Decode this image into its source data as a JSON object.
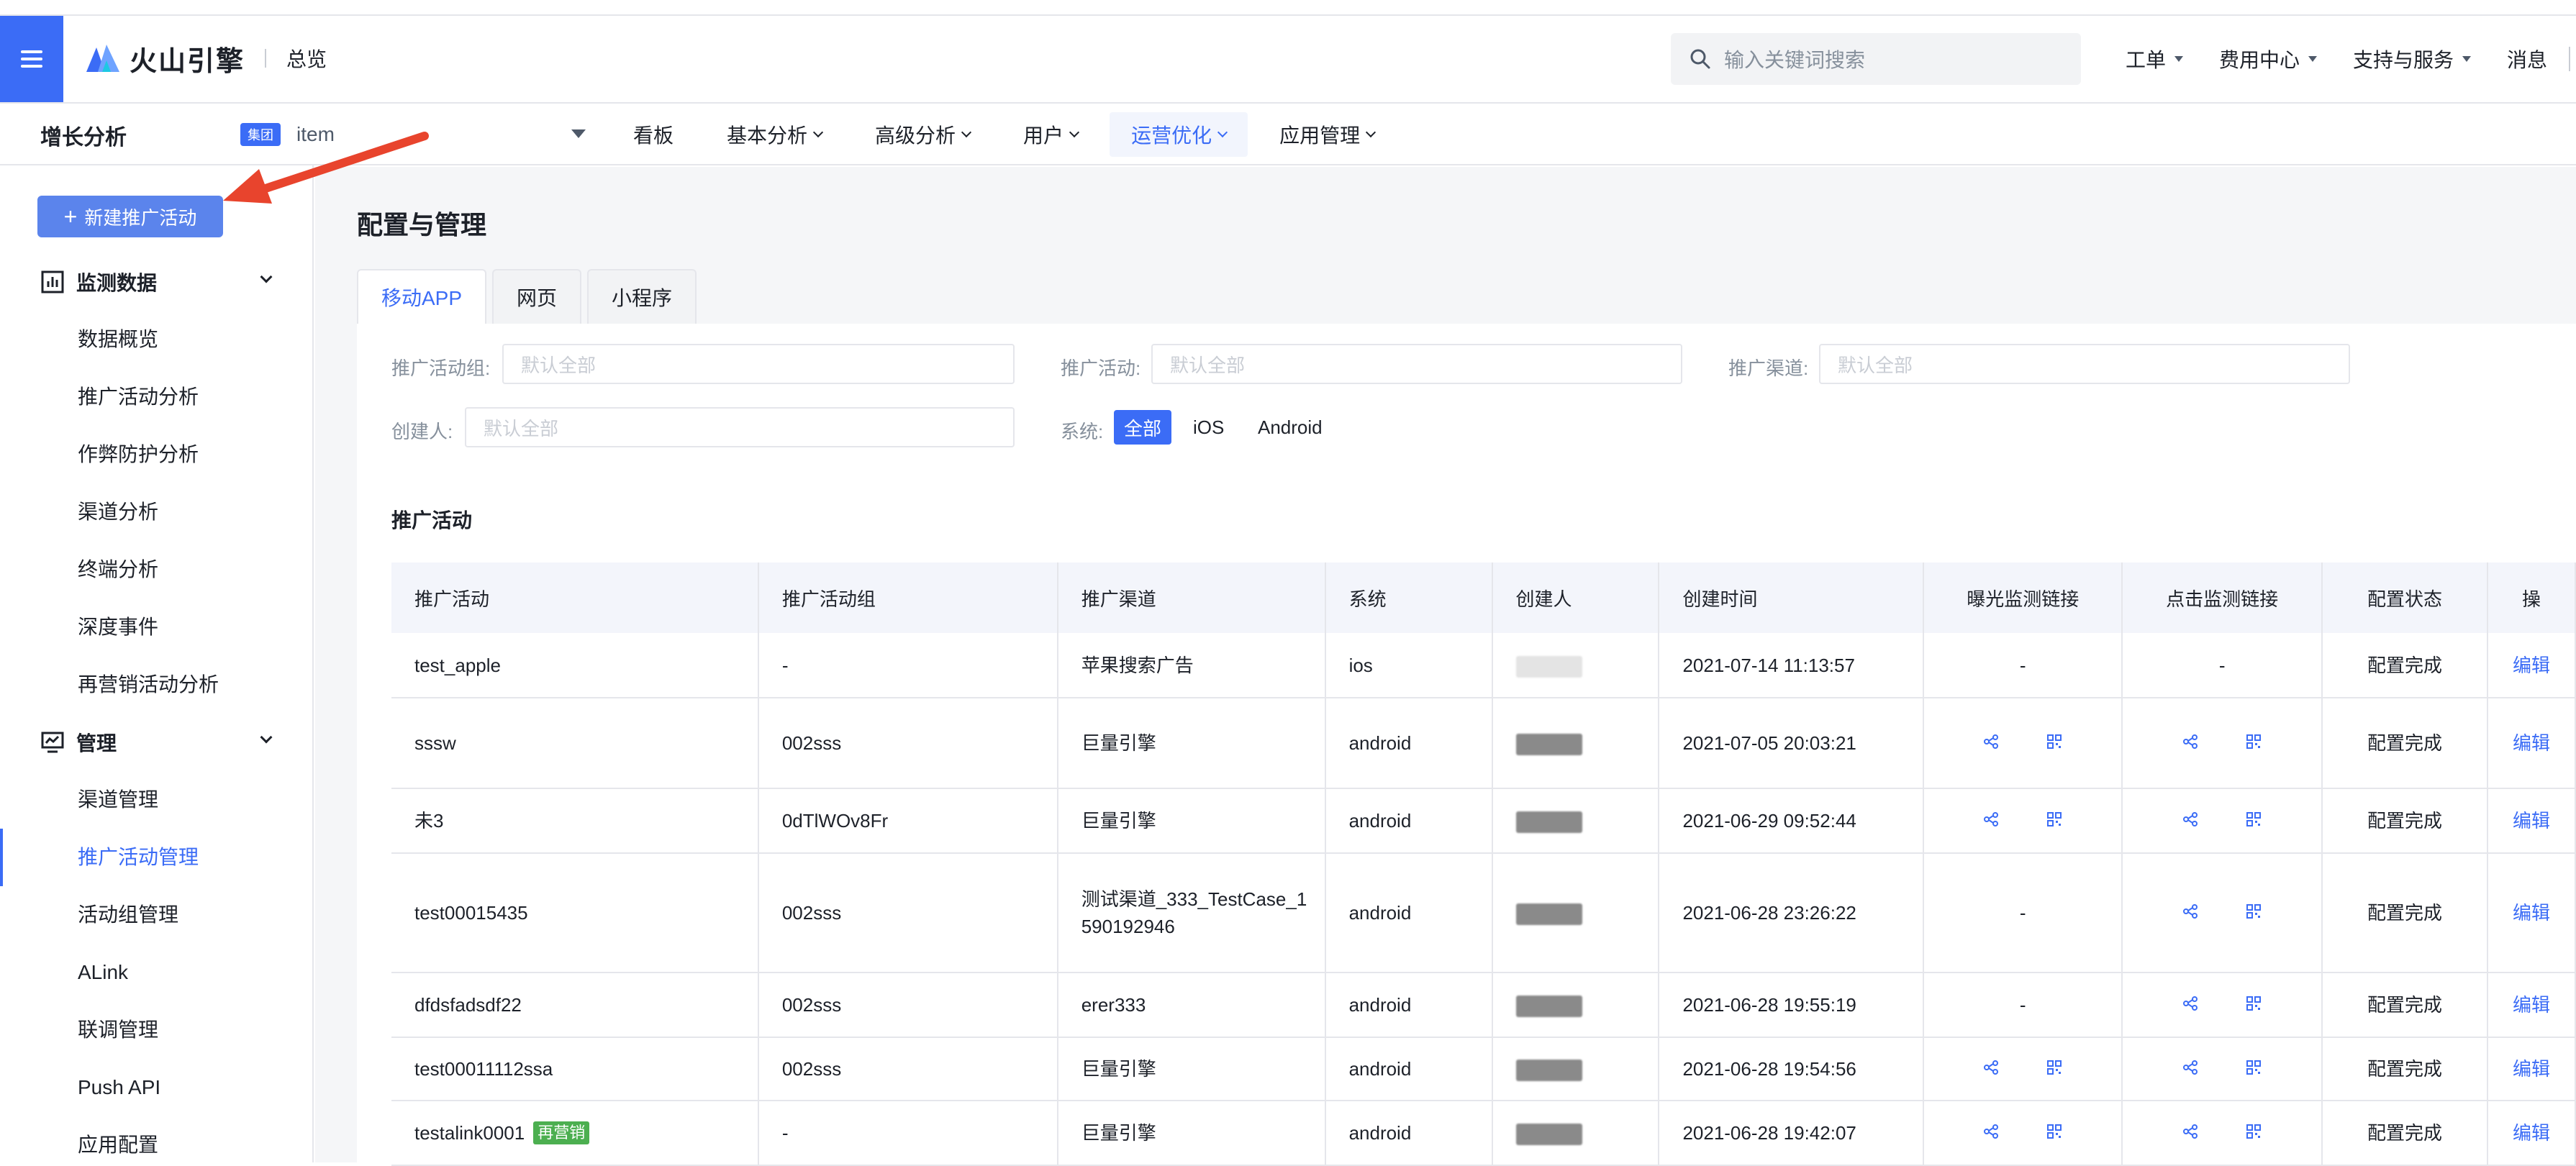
{
  "header": {
    "brand": "火山引擎",
    "section": "总览",
    "search_placeholder": "输入关键词搜索",
    "nav": [
      "工单",
      "费用中心",
      "支持与服务",
      "消息"
    ]
  },
  "subbar": {
    "product": "增长分析",
    "group_tag": "集团",
    "app_name": "item",
    "tabs": [
      "看板",
      "基本分析",
      "高级分析",
      "用户",
      "运营优化",
      "应用管理"
    ],
    "active_tab": "运营优化"
  },
  "sidebar": {
    "new_button": "新建推广活动",
    "group1": "监测数据",
    "group1_items": [
      "数据概览",
      "推广活动分析",
      "作弊防护分析",
      "渠道分析",
      "终端分析",
      "深度事件",
      "再营销活动分析"
    ],
    "group2": "管理",
    "group2_items": [
      "渠道管理",
      "推广活动管理",
      "活动组管理",
      "ALink",
      "联调管理",
      "Push API",
      "应用配置"
    ],
    "active_item": "推广活动管理"
  },
  "page": {
    "title": "配置与管理",
    "tabs": [
      "移动APP",
      "网页",
      "小程序"
    ],
    "active_tab": "移动APP"
  },
  "filters": {
    "group_label": "推广活动组:",
    "campaign_label": "推广活动:",
    "channel_label": "推广渠道:",
    "creator_label": "创建人:",
    "placeholder": "默认全部",
    "system_label": "系统:",
    "system_options": [
      "全部",
      "iOS",
      "Android"
    ],
    "system_selected": "全部"
  },
  "table": {
    "title": "推广活动",
    "columns": [
      "推广活动",
      "推广活动组",
      "推广渠道",
      "系统",
      "创建人",
      "创建时间",
      "曝光监测链接",
      "点击监测链接",
      "配置状态",
      "操"
    ],
    "rows": [
      {
        "name": "test_apple",
        "tag": "",
        "group": "-",
        "channel": "苹果搜索广告",
        "system": "ios",
        "time": "2021-07-14 11:13:57",
        "imp": "-",
        "click": "-",
        "status": "配置完成",
        "action": "编辑"
      },
      {
        "name": "sssw",
        "tag": "",
        "group": "002sss",
        "channel": "巨量引擎",
        "system": "android",
        "time": "2021-07-05 20:03:21",
        "imp": "icons",
        "click": "icons",
        "status": "配置完成",
        "action": "编辑"
      },
      {
        "name": "未3",
        "tag": "",
        "group": "0dTlWOv8Fr",
        "channel": "巨量引擎",
        "system": "android",
        "time": "2021-06-29 09:52:44",
        "imp": "icons",
        "click": "icons",
        "status": "配置完成",
        "action": "编辑"
      },
      {
        "name": "test00015435",
        "tag": "",
        "group": "002sss",
        "channel": "测试渠道_333_TestCase_1590192946",
        "system": "android",
        "time": "2021-06-28 23:26:22",
        "imp": "-",
        "click": "icons",
        "status": "配置完成",
        "action": "编辑"
      },
      {
        "name": "dfdsfadsdf22",
        "tag": "",
        "group": "002sss",
        "channel": "erer333",
        "system": "android",
        "time": "2021-06-28 19:55:19",
        "imp": "-",
        "click": "icons",
        "status": "配置完成",
        "action": "编辑"
      },
      {
        "name": "test00011112ssa",
        "tag": "",
        "group": "002sss",
        "channel": "巨量引擎",
        "system": "android",
        "time": "2021-06-28 19:54:56",
        "imp": "icons",
        "click": "icons",
        "status": "配置完成",
        "action": "编辑"
      },
      {
        "name": "testalink0001",
        "tag": "再营销",
        "group": "-",
        "channel": "巨量引擎",
        "system": "android",
        "time": "2021-06-28 19:42:07",
        "imp": "icons",
        "click": "icons",
        "status": "配置完成",
        "action": "编辑"
      }
    ]
  },
  "colors": {
    "primary": "#3b6cf6",
    "tag_green": "#4caf50",
    "annotation": "#e8442d"
  }
}
